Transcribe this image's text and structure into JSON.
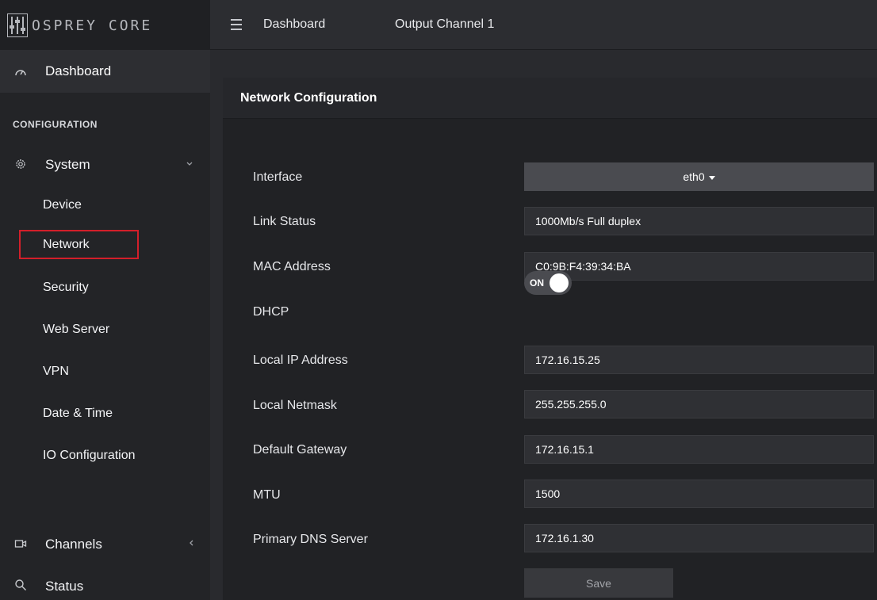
{
  "header": {
    "brand": "OSPREY CORE",
    "breadcrumbs": [
      "Dashboard",
      "Output Channel 1"
    ]
  },
  "sidebar": {
    "dashboard": "Dashboard",
    "section": "CONFIGURATION",
    "system": "System",
    "system_items": [
      "Device",
      "Network",
      "Security",
      "Web Server",
      "VPN",
      "Date & Time",
      "IO Configuration"
    ],
    "active_item": "Network",
    "channels": "Channels",
    "status": "Status"
  },
  "panel": {
    "title": "Network Configuration",
    "fields": [
      {
        "label": "Interface",
        "value": "eth0"
      },
      {
        "label": "Link Status",
        "value": "1000Mb/s Full duplex"
      },
      {
        "label": "MAC Address",
        "value": "C0:9B:F4:39:34:BA"
      },
      {
        "label": "DHCP",
        "value": "ON"
      },
      {
        "label": "Local IP Address",
        "value": "172.16.15.25"
      },
      {
        "label": "Local Netmask",
        "value": "255.255.255.0"
      },
      {
        "label": "Default Gateway",
        "value": "172.16.15.1"
      },
      {
        "label": "MTU",
        "value": "1500"
      },
      {
        "label": "Primary DNS Server",
        "value": "172.16.1.30"
      }
    ],
    "save_label": "Save"
  },
  "icons": {
    "logo": "mixer-sliders-logo",
    "menu": "hamburger-icon",
    "dashboard": "speedometer-icon",
    "system": "gear-icon",
    "channels": "video-camera-icon",
    "status": "search-icon"
  },
  "colors": {
    "highlight": "#d31f2a",
    "sidebar_bg": "#232427",
    "panel_bg": "#212225"
  }
}
